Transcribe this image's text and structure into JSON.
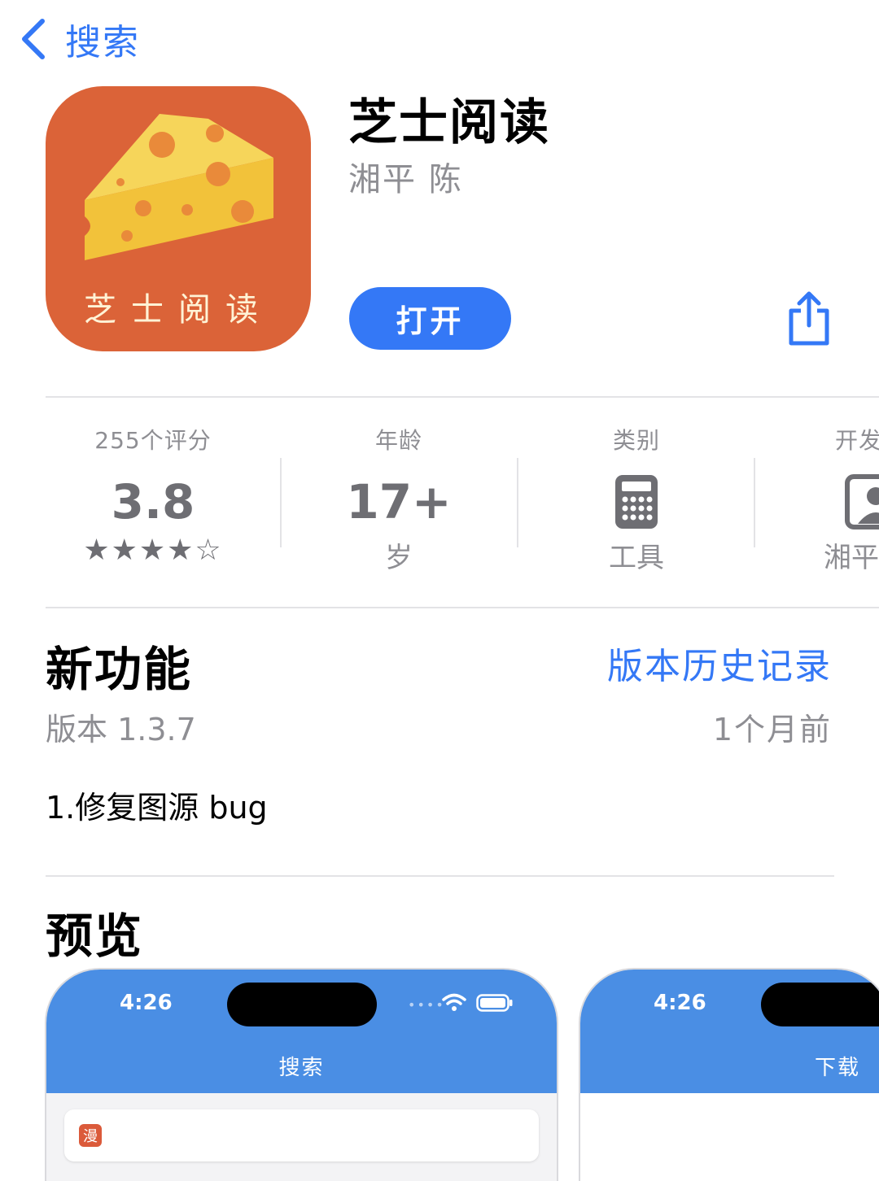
{
  "nav": {
    "back_label": "搜索"
  },
  "app": {
    "name": "芝士阅读",
    "developer": "湘平 陈",
    "icon_text": "芝士阅读",
    "open_label": "打开",
    "accent_color": "#3478F6",
    "icon_bg_color": "#DB6338"
  },
  "info": [
    {
      "label": "255个评分",
      "value": "3.8",
      "stars": "★★★★☆"
    },
    {
      "label": "年龄",
      "value": "17+",
      "sub": "岁"
    },
    {
      "label": "类别",
      "icon": "calculator-icon",
      "sub": "工具"
    },
    {
      "label": "开发",
      "icon": "developer-person-icon",
      "sub": "湘平"
    }
  ],
  "whats_new": {
    "title": "新功能",
    "history_link": "版本历史记录",
    "version": "版本 1.3.7",
    "date": "1个月前",
    "notes": "1.修复图源 bug"
  },
  "preview": {
    "title": "预览",
    "screens": [
      {
        "time": "4:26",
        "nav_title": "搜索",
        "badge": "漫"
      },
      {
        "time": "4:26",
        "nav_title": "下载"
      }
    ]
  }
}
